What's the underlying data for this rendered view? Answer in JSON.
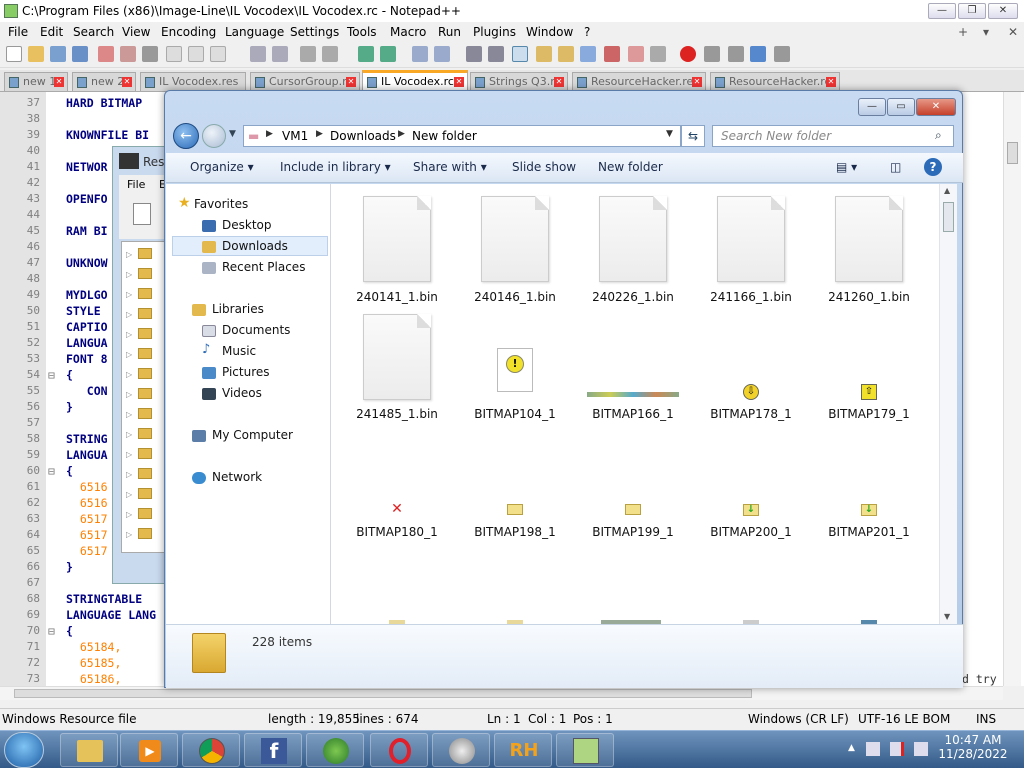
{
  "notepad": {
    "title": "C:\\Program Files (x86)\\Image-Line\\IL Vocodex\\IL Vocodex.rc - Notepad++",
    "menu": [
      "File",
      "Edit",
      "Search",
      "View",
      "Encoding",
      "Language",
      "Settings",
      "Tools",
      "Macro",
      "Run",
      "Plugins",
      "Window",
      "?"
    ],
    "tabs": [
      {
        "label": "new 1"
      },
      {
        "label": "new 2"
      },
      {
        "label": "IL Vocodex.res"
      },
      {
        "label": "CursorGroup.rc"
      },
      {
        "label": "IL Vocodex.rc",
        "active": true
      },
      {
        "label": "Strings Q3.rc"
      },
      {
        "label": "ResourceHacker.res"
      },
      {
        "label": "ResourceHacker.rc"
      }
    ],
    "lines": [
      {
        "n": "37",
        "t": "HARD BITMAP"
      },
      {
        "n": "38",
        "t": ""
      },
      {
        "n": "39",
        "t": "KNOWNFILE BI"
      },
      {
        "n": "40",
        "t": ""
      },
      {
        "n": "41",
        "t": "NETWOR"
      },
      {
        "n": "42",
        "t": ""
      },
      {
        "n": "43",
        "t": "OPENFO"
      },
      {
        "n": "44",
        "t": ""
      },
      {
        "n": "45",
        "t": "RAM BI"
      },
      {
        "n": "46",
        "t": ""
      },
      {
        "n": "47",
        "t": "UNKNOW"
      },
      {
        "n": "48",
        "t": ""
      },
      {
        "n": "49",
        "t": "MYDLGO"
      },
      {
        "n": "50",
        "t": "STYLE"
      },
      {
        "n": "51",
        "t": "CAPTIO"
      },
      {
        "n": "52",
        "t": "LANGUA"
      },
      {
        "n": "53",
        "t": "FONT 8"
      },
      {
        "n": "54",
        "t": "{"
      },
      {
        "n": "55",
        "t": "   CON"
      },
      {
        "n": "56",
        "t": "}"
      },
      {
        "n": "57",
        "t": ""
      },
      {
        "n": "58",
        "t": "STRING"
      },
      {
        "n": "59",
        "t": "LANGUA"
      },
      {
        "n": "60",
        "t": "{"
      },
      {
        "n": "61",
        "t": "  6516"
      },
      {
        "n": "62",
        "t": "  6516"
      },
      {
        "n": "63",
        "t": "  6517"
      },
      {
        "n": "64",
        "t": "  6517"
      },
      {
        "n": "65",
        "t": "  6517"
      },
      {
        "n": "66",
        "t": "}"
      },
      {
        "n": "67",
        "t": ""
      },
      {
        "n": "68",
        "t": "STRINGTABLE"
      },
      {
        "n": "69",
        "t": "LANGUAGE LANG"
      },
      {
        "n": "70",
        "t": "{"
      },
      {
        "n": "71",
        "t": "  65184,"
      },
      {
        "n": "72",
        "t": "  65185,"
      },
      {
        "n": "73",
        "t": "  65186,"
      }
    ],
    "right_text": "d try",
    "status": {
      "type": "Windows Resource file",
      "length": "length : 19,855",
      "lines": "lines : 674",
      "ln": "Ln : 1",
      "col": "Col : 1",
      "pos": "Pos : 1",
      "eol": "Windows (CR LF)",
      "encoding": "UTF-16 LE BOM",
      "mode": "INS"
    }
  },
  "rh": {
    "title": "Reso",
    "menu_file": "File",
    "menu_e": "E",
    "logo": "RH"
  },
  "explorer": {
    "breadcrumb": [
      "VM1",
      "Downloads",
      "New folder"
    ],
    "search_placeholder": "Search New folder",
    "commands": [
      "Organize",
      "Include in library",
      "Share with",
      "Slide show",
      "New folder"
    ],
    "nav": {
      "favorites_label": "Favorites",
      "favorites": [
        "Desktop",
        "Downloads",
        "Recent Places"
      ],
      "libraries_label": "Libraries",
      "libraries": [
        "Documents",
        "Music",
        "Pictures",
        "Videos"
      ],
      "computer": "My Computer",
      "network": "Network"
    },
    "items": [
      "240141_1.bin",
      "240146_1.bin",
      "240226_1.bin",
      "241166_1.bin",
      "241260_1.bin",
      "241485_1.bin",
      "BITMAP104_1",
      "BITMAP166_1",
      "BITMAP178_1",
      "BITMAP179_1",
      "BITMAP180_1",
      "BITMAP198_1",
      "BITMAP199_1",
      "BITMAP200_1",
      "BITMAP201_1"
    ],
    "details": "228 items"
  },
  "taskbar": {
    "time": "10:47 AM",
    "date": "11/28/2022"
  }
}
